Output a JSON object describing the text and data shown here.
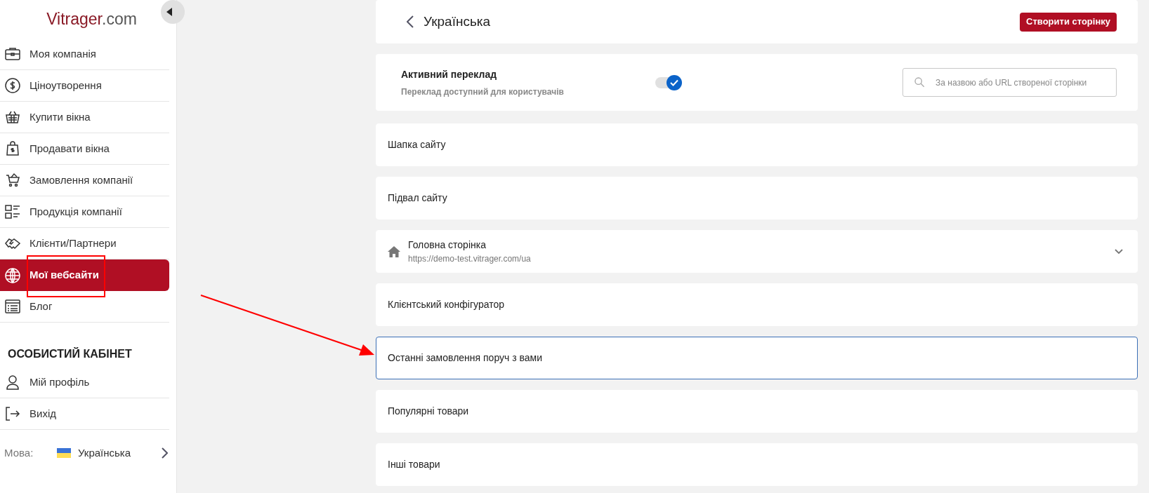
{
  "sidebar": {
    "logo": {
      "brand": "Vitrager",
      "suffix": ".com"
    },
    "items": [
      {
        "label": "Моя компанія",
        "selected": false
      },
      {
        "label": "Ціноутворення",
        "selected": false
      },
      {
        "label": "Купити вікна",
        "selected": false
      },
      {
        "label": "Продавати вікна",
        "selected": false
      },
      {
        "label": "Замовлення компанії",
        "selected": false
      },
      {
        "label": "Продукція компанії",
        "selected": false
      },
      {
        "label": "Клієнти/Партнери",
        "selected": false
      },
      {
        "label": "Мої вебсайти",
        "selected": true
      },
      {
        "label": "Блог",
        "selected": false
      }
    ],
    "section_title": "ОСОБИСТИЙ КАБІНЕТ",
    "account_items": [
      {
        "label": "Мій профіль"
      },
      {
        "label": "Вихід"
      }
    ],
    "language": {
      "label": "Мова:",
      "value": "Українська"
    }
  },
  "header": {
    "title": "Українська",
    "button": "Створити сторінку"
  },
  "translation": {
    "title": "Активний переклад",
    "subtitle": "Переклад доступний для користувачів",
    "on": true,
    "search": {
      "placeholder": "За назвою або URL створеної сторінки"
    }
  },
  "pages": [
    {
      "kind": "plain",
      "title": "Шапка сайту",
      "selected": false
    },
    {
      "kind": "plain",
      "title": "Підвал сайту",
      "selected": false
    },
    {
      "kind": "home",
      "title": "Головна сторінка",
      "url": "https://demo-test.vitrager.com/ua",
      "selected": false
    },
    {
      "kind": "plain",
      "title": "Клієнтський конфігуратор",
      "selected": false
    },
    {
      "kind": "plain",
      "title": "Останні замовлення поруч з вами",
      "selected": true
    },
    {
      "kind": "plain",
      "title": "Популярні товари",
      "selected": false
    },
    {
      "kind": "plain",
      "title": "Інші товари",
      "selected": false
    }
  ]
}
